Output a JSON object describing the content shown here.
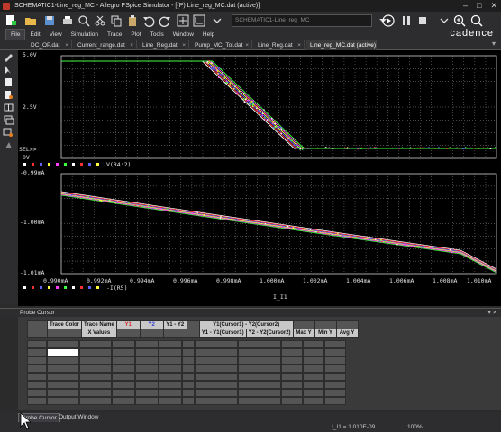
{
  "window": {
    "title": "SCHEMATIC1-Line_reg_MC - Allegro PSpice Simulator - [(P) Line_reg_MC.dat (active)]",
    "controls": [
      "–",
      "□",
      "✕"
    ]
  },
  "toolbar": {
    "combo_value": "SCHEMATIC1-Line_reg_MC",
    "brand": "cadence"
  },
  "menu": [
    "File",
    "Edit",
    "View",
    "Simulation",
    "Trace",
    "Plot",
    "Tools",
    "Window",
    "Help"
  ],
  "tabs": [
    {
      "label": "DC_OP.dat"
    },
    {
      "label": "Current_range.dat"
    },
    {
      "label": "Line_Reg.dat"
    },
    {
      "label": "Pump_MC_Tol.dat"
    },
    {
      "label": "Line_Reg.dat"
    },
    {
      "label": "Line_reg_MC.dat (active)"
    }
  ],
  "plot": {
    "top_y_ticks": [
      "5.0V",
      "2.5V",
      "0V"
    ],
    "sel_marker": "SEL>>",
    "top_legend": "V(R4:2)",
    "bottom_y_ticks": [
      "-0.99mA",
      "-1.00mA",
      "-1.01mA"
    ],
    "bottom_legend": "-I(R5)",
    "x_ticks": [
      "0.990mA",
      "0.992mA",
      "0.994mA",
      "0.996mA",
      "0.998mA",
      "1.000mA",
      "1.002mA",
      "1.004mA",
      "1.006mA",
      "1.008mA",
      "1.010mA"
    ],
    "x_label": "I_I1",
    "colors": {
      "grid": "#8a8a8a",
      "trace_white": "#ffffff",
      "trace_red": "#ff3030",
      "trace_blue": "#6060ff",
      "trace_yellow": "#ffff40",
      "trace_magenta": "#ff40ff",
      "trace_green": "#40ff40"
    }
  },
  "probe_cursor": {
    "panel_title": "Probe Cursor",
    "headers_row1": [
      "Trace Color",
      "Trace Name",
      "Y1",
      "Y2",
      "Y1 - Y2",
      "Y1(Cursor1) - Y2(Cursor2)"
    ],
    "headers_row2": [
      "X Values",
      "Y1 - Y1(Cursor1)",
      "Y2 - Y2(Cursor2)",
      "Max Y",
      "Min Y",
      "Avg Y"
    ],
    "y1_color": "#d03030",
    "y2_color": "#3040d0"
  },
  "bottom_tabs": [
    "Probe Cursor",
    "Output Window"
  ],
  "status": {
    "left": "",
    "cursor_readout": "I_I1 = 1.010E-09",
    "zoom": "100%"
  }
}
